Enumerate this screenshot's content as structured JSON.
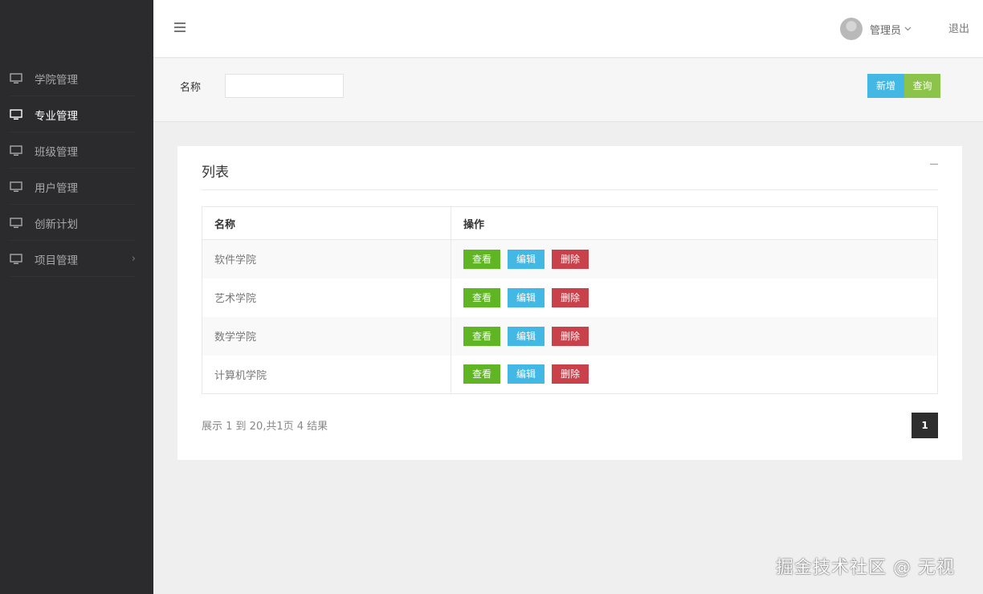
{
  "sidebar": {
    "items": [
      {
        "label": "学院管理",
        "icon": "monitor-icon",
        "active": false
      },
      {
        "label": "专业管理",
        "icon": "monitor-icon",
        "active": true
      },
      {
        "label": "班级管理",
        "icon": "monitor-icon",
        "active": false
      },
      {
        "label": "用户管理",
        "icon": "monitor-icon",
        "active": false
      },
      {
        "label": "创新计划",
        "icon": "monitor-icon",
        "active": false
      },
      {
        "label": "项目管理",
        "icon": "monitor-icon",
        "active": false,
        "arrow": "›"
      }
    ]
  },
  "header": {
    "user_name": "管理员",
    "logout_label": "退出"
  },
  "search": {
    "name_label": "名称",
    "name_value": "",
    "add_label": "新增",
    "query_label": "查询"
  },
  "card": {
    "title": "列表",
    "columns": [
      "名称",
      "操作"
    ],
    "rows": [
      {
        "name": "软件学院"
      },
      {
        "name": "艺术学院"
      },
      {
        "name": "数学学院"
      },
      {
        "name": "计算机学院"
      }
    ],
    "actions": {
      "view": "查看",
      "edit": "编辑",
      "delete": "删除"
    },
    "pager_info": "展示 1 到 20,共1页 4 结果",
    "current_page": "1"
  },
  "colors": {
    "sidebar_bg": "#2b2b2d",
    "add_button": "#44b8e4",
    "query_button": "#8cc34b",
    "view_button": "#5fb523",
    "edit_button": "#44b8e4",
    "delete_button": "#c9414a",
    "pager_active": "#2e2e2e"
  },
  "watermark": "掘金技术社区 @ 无视"
}
